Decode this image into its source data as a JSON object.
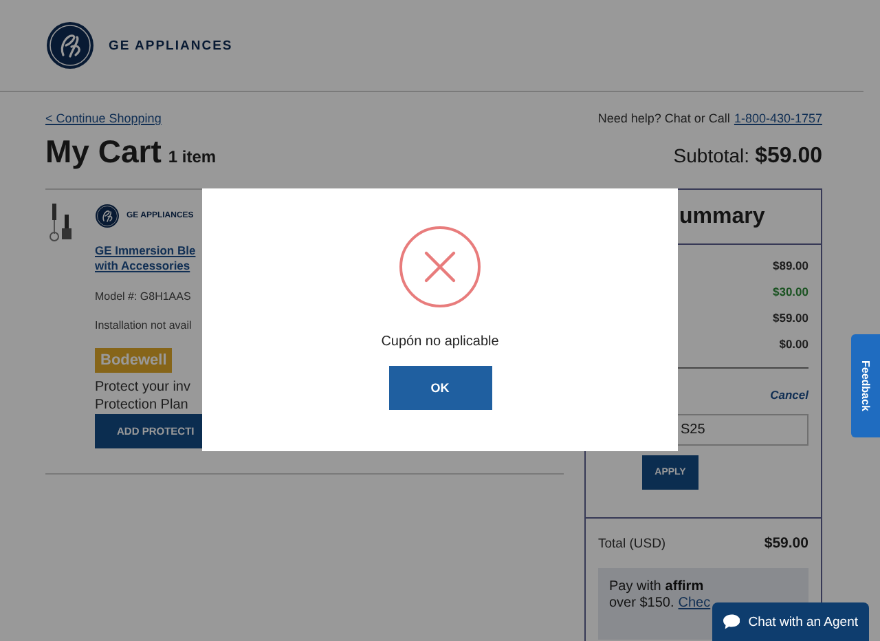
{
  "header": {
    "logo_text": "GE APPLIANCES"
  },
  "nav": {
    "continue_link": "< Continue Shopping",
    "help_text": "Need help? Chat or Call",
    "phone_link": "1-800-430-1757"
  },
  "cart": {
    "title": "My Cart",
    "count": "1 item",
    "subtotal_label": "Subtotal:",
    "subtotal_value": "$59.00"
  },
  "item": {
    "brand": "GE APPLIANCES",
    "name_lines": [
      "GE Immersion Ble",
      "with Accessories"
    ],
    "model": "Model #: G8H1AAS",
    "installation": "Installation not avail",
    "protection_brand": "Bodewell",
    "protection_lines": [
      "Protect your inv",
      "Protection Plan"
    ],
    "protection_button": "ADD PROTECTI"
  },
  "summary": {
    "title": "ummary",
    "rows": [
      {
        "value": "$89.00",
        "kind": "normal"
      },
      {
        "value": "$30.00",
        "kind": "discount"
      },
      {
        "value": "$59.00",
        "kind": "normal"
      },
      {
        "value": "$0.00",
        "kind": "normal"
      }
    ],
    "cancel": "Cancel",
    "coupon_value": "S25",
    "apply": "APPLY",
    "total_label": "Total (USD)",
    "total_value": "$59.00",
    "affirm": {
      "text": "Pay with",
      "brand": "affirm",
      "line2": "over $150.",
      "link": "Chec"
    }
  },
  "modal": {
    "message": "Cupón no aplicable",
    "button": "OK"
  },
  "feedback": "Feedback",
  "chat": "Chat with an Agent"
}
